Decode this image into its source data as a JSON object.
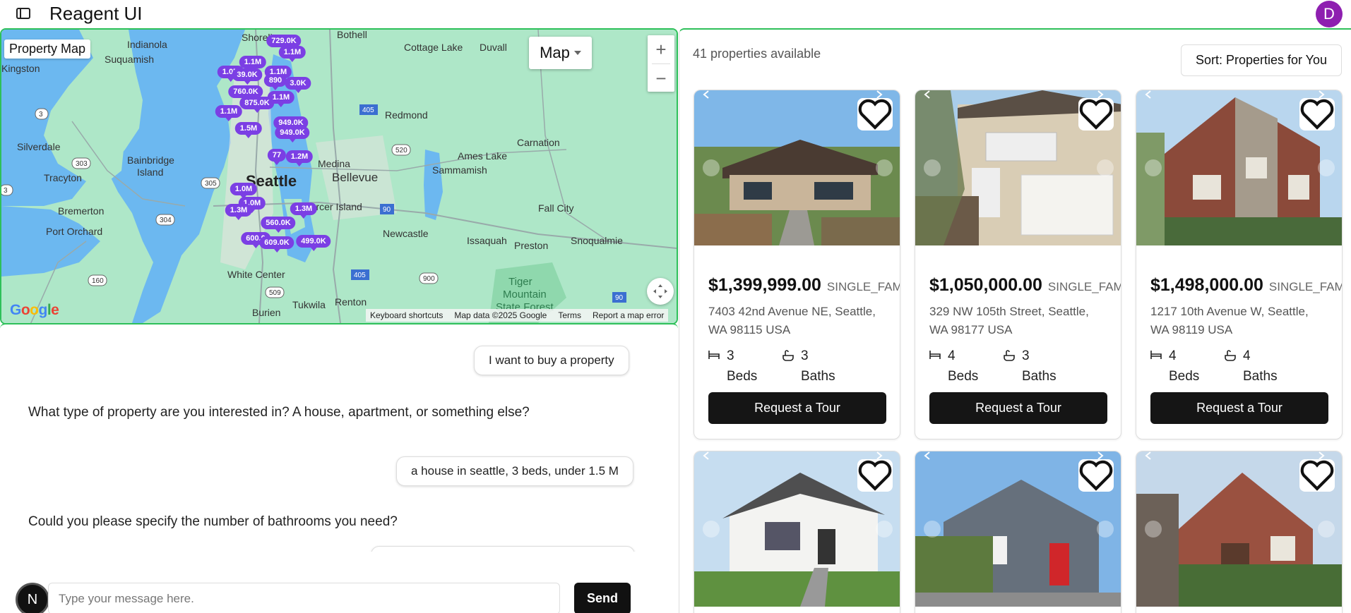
{
  "app": {
    "title": "Reagent UI",
    "avatar_letter": "D"
  },
  "map": {
    "title": "Property Map",
    "type_label": "Map",
    "zoom_in": "+",
    "zoom_out": "−",
    "google": [
      "G",
      "o",
      "o",
      "g",
      "l",
      "e"
    ],
    "attribution": [
      "Keyboard shortcuts",
      "Map data ©2025 Google",
      "Terms",
      "Report a map error"
    ],
    "places": [
      "Shoreline",
      "Bothell",
      "Cottage Lake",
      "Duvall",
      "Indianola",
      "Suquamish",
      "Kingston",
      "Redmond",
      "Carnation",
      "Silverdale",
      "Bainbridge Island",
      "Ames Lake",
      "Tracyton",
      "Medina",
      "Bellevue",
      "Sammamish",
      "Bremerton",
      "Seattle",
      "Mercer Island",
      "Fall City",
      "Port Orchard",
      "Newcastle",
      "Issaquah",
      "Preston",
      "Snoqualmie",
      "White Center",
      "Tukwila",
      "Renton",
      "Burien",
      "Tiger Mountain State Forest"
    ],
    "place_short": {
      "bainbridge_line1": "Bainbridge",
      "bainbridge_line2": "Island",
      "tiger_line1": "Tiger",
      "tiger_line2": "Mountain",
      "tiger_line3": "State Forest"
    },
    "routes": [
      "303",
      "305",
      "304",
      "160",
      "3",
      "3",
      "405",
      "520",
      "90",
      "90",
      "405",
      "509",
      "900",
      "90"
    ],
    "markers": [
      "729.0K",
      "1.1M",
      "1.1M",
      "1.1M",
      "890",
      "760.0K",
      "1.1M",
      "875.0K",
      "1.1M",
      "1.5M",
      "949.0K",
      "1.2M",
      "77",
      "1.2M",
      "1.0M",
      "1.3M",
      "1.3M",
      "560.0K",
      "600.0",
      "609.0K",
      "499.0K",
      "1.0M",
      "3.0K",
      "39.0K"
    ]
  },
  "chat": {
    "messages": [
      {
        "role": "user",
        "text": "I want to buy a property"
      },
      {
        "role": "assistant",
        "text": "What type of property are you interested in? A house, apartment, or something else?"
      },
      {
        "role": "user",
        "text": "a house in seattle, 3 beds, under 1.5 M"
      },
      {
        "role": "assistant",
        "text": "Could you please specify the number of bathrooms you need?"
      }
    ],
    "avatar_letter": "N",
    "placeholder": "Type your message here.",
    "send_label": "Send"
  },
  "listings": {
    "count_text": "41 properties available",
    "sort_label": "Sort: Properties for You",
    "tour_label": "Request a Tour",
    "cards": [
      {
        "price": "$1,399,999.00",
        "type": "SINGLE_FAMILY",
        "addr1": "7403 42nd Avenue NE, Seattle,",
        "addr2": "WA 98115 USA",
        "beds": "3",
        "beds_label": "Beds",
        "baths": "3",
        "baths_label": "Baths"
      },
      {
        "price": "$1,050,000.00",
        "type": "SINGLE_FAMILY",
        "addr1": "329 NW 105th Street, Seattle,",
        "addr2": "WA 98177 USA",
        "beds": "4",
        "beds_label": "Beds",
        "baths": "3",
        "baths_label": "Baths"
      },
      {
        "price": "$1,498,000.00",
        "type": "SINGLE_FAMILY",
        "addr1": "1217 10th Avenue W, Seattle,",
        "addr2": "WA 98119 USA",
        "beds": "4",
        "beds_label": "Beds",
        "baths": "4",
        "baths_label": "Baths"
      }
    ]
  },
  "colors": {
    "accent": "#2ec05a",
    "marker": "#7b3fe4",
    "avatar": "#8e1fb0",
    "button": "#151515"
  }
}
